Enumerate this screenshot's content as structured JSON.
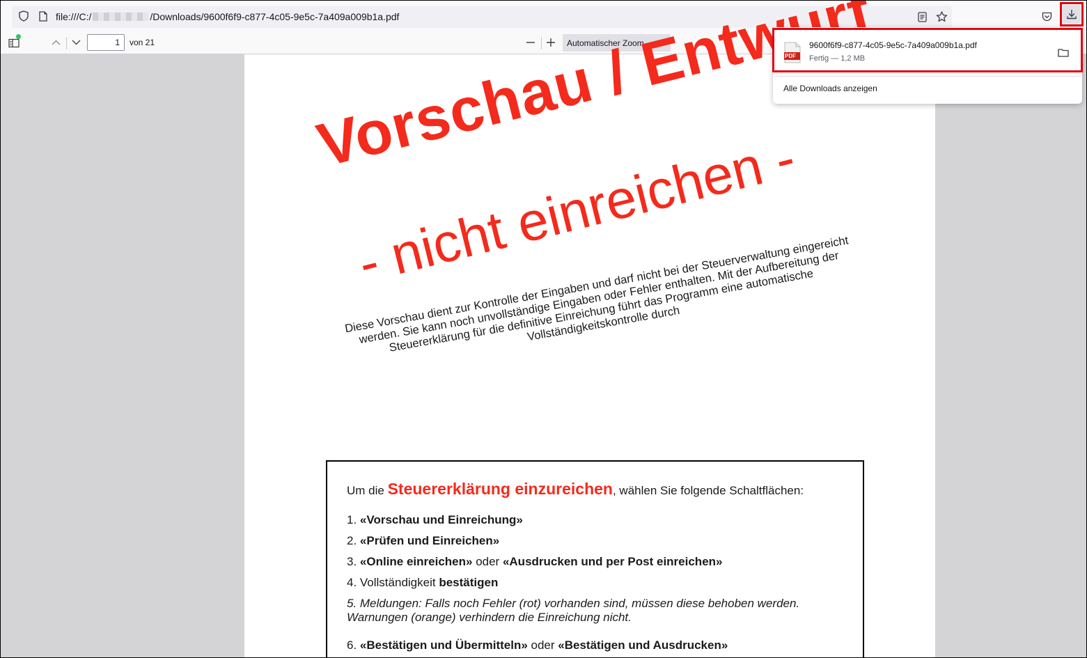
{
  "urlbar": {
    "url_prefix": "file:///C:/",
    "url_suffix": "/Downloads/9600f6f9-c877-4c05-9e5c-7a409a009b1a.pdf"
  },
  "pdf_toolbar": {
    "page_number": "1",
    "page_count_label": "von 21",
    "zoom_label": "Automatischer Zoom"
  },
  "document": {
    "watermark_title": "Vorschau / Entwurf",
    "watermark_subtitle": "- nicht einreichen -",
    "watermark_note": "Diese Vorschau dient zur Kontrolle der Eingaben und darf nicht bei der Steuerverwaltung eingereicht werden. Sie kann noch unvollständige Eingaben oder Fehler enthalten. Mit der Aufbereitung der Steuererklärung für die definitive Einreichung führt das Programm eine automatische Vollständigkeitskontrolle durch",
    "intro_prefix": "Um die ",
    "intro_highlight": "Steuererklärung einzureichen",
    "intro_suffix": ", wählen Sie folgende Schaltflächen:",
    "step1_num": "1. ",
    "step1_bold": "«Vorschau und Einreichung»",
    "step2_num": "2. ",
    "step2_bold": "«Prüfen und Einreichen»",
    "step3_num": "3. ",
    "step3_bold_a": "«Online einreichen»",
    "step3_mid": " oder ",
    "step3_bold_b": "«Ausdrucken und per Post einreichen»",
    "step4_text": "4. Vollständigkeit ",
    "step4_bold": "bestätigen",
    "step5_italic": "5. Meldungen: Falls noch Fehler (rot) vorhanden sind, müssen diese behoben werden. Warnungen (orange) verhindern die Einreichung nicht.",
    "step6_num": "6. ",
    "step6_bold_a": "«Bestätigen und Übermitteln»",
    "step6_mid": " oder ",
    "step6_bold_b": "«Bestätigen und Ausdrucken»"
  },
  "downloads_panel": {
    "file_name": "9600f6f9-c877-4c05-9e5c-7a409a009b1a.pdf",
    "file_status": "Fertig — 1,2 MB",
    "file_type_label": "PDF",
    "show_all_label": "Alle Downloads anzeigen"
  },
  "colors": {
    "watermark_red": "#f42a1c",
    "highlight_red": "#e3000f"
  }
}
